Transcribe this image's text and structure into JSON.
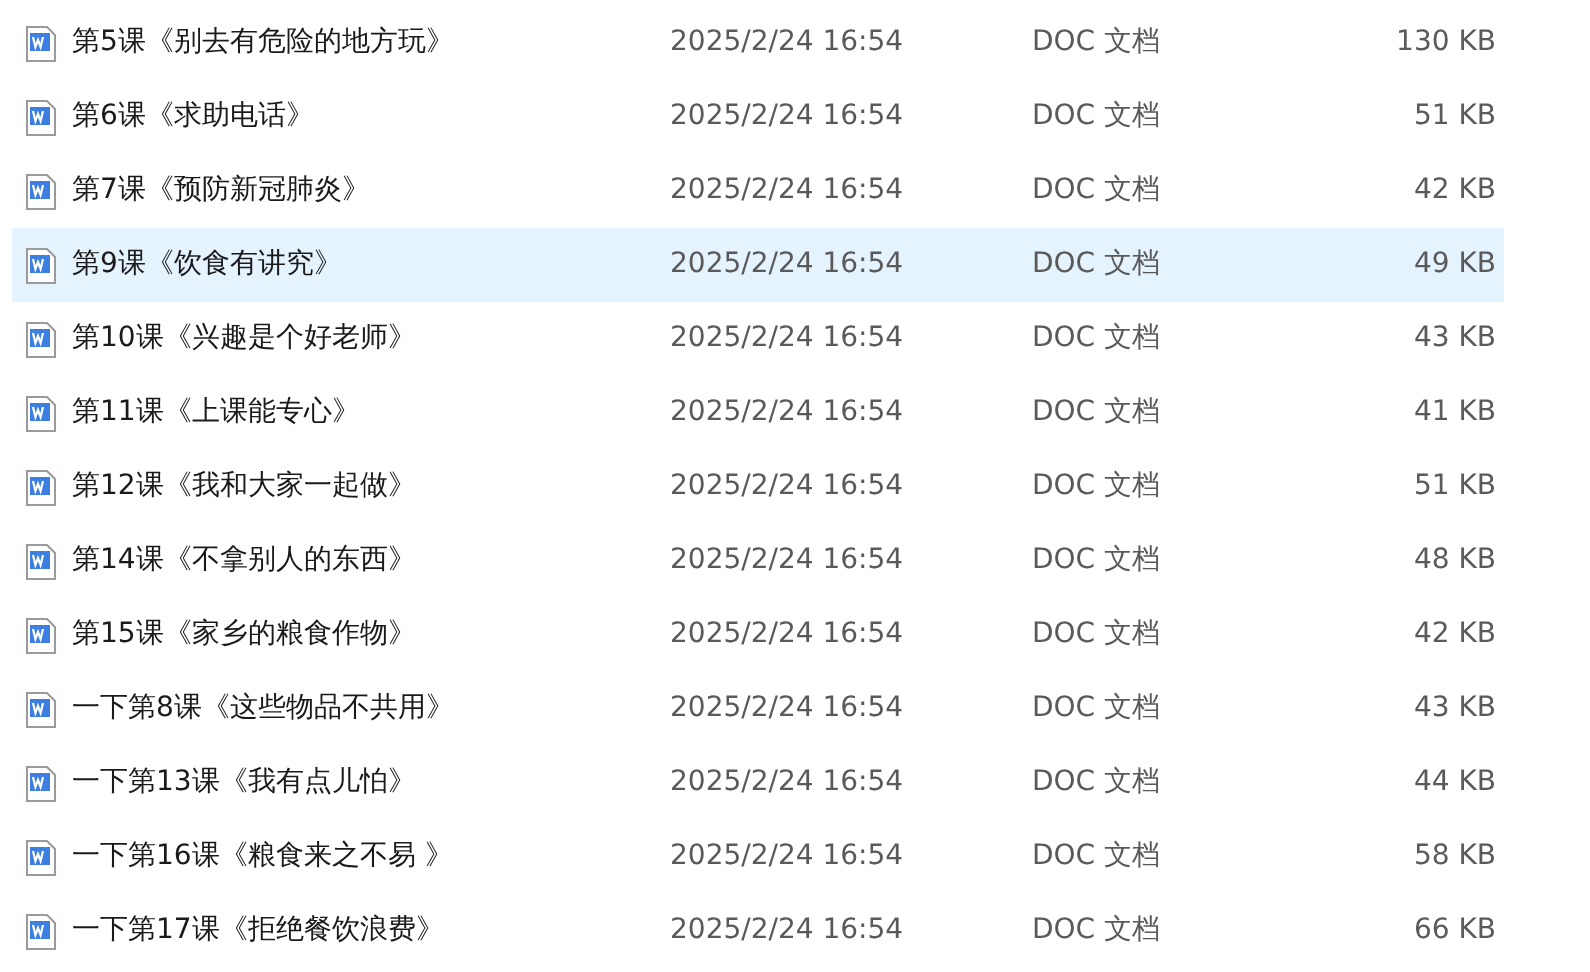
{
  "files": [
    {
      "name": "第5课《别去有危险的地方玩》",
      "modified": "2025/2/24 16:54",
      "type": "DOC 文档",
      "size": "130 KB",
      "selected": false
    },
    {
      "name": "第6课《求助电话》",
      "modified": "2025/2/24 16:54",
      "type": "DOC 文档",
      "size": "51 KB",
      "selected": false
    },
    {
      "name": "第7课《预防新冠肺炎》",
      "modified": "2025/2/24 16:54",
      "type": "DOC 文档",
      "size": "42 KB",
      "selected": false
    },
    {
      "name": "第9课《饮食有讲究》",
      "modified": "2025/2/24 16:54",
      "type": "DOC 文档",
      "size": "49 KB",
      "selected": true
    },
    {
      "name": "第10课《兴趣是个好老师》",
      "modified": "2025/2/24 16:54",
      "type": "DOC 文档",
      "size": "43 KB",
      "selected": false
    },
    {
      "name": "第11课《上课能专心》",
      "modified": "2025/2/24 16:54",
      "type": "DOC 文档",
      "size": "41 KB",
      "selected": false
    },
    {
      "name": "第12课《我和大家一起做》",
      "modified": "2025/2/24 16:54",
      "type": "DOC 文档",
      "size": "51 KB",
      "selected": false
    },
    {
      "name": "第14课《不拿别人的东西》",
      "modified": "2025/2/24 16:54",
      "type": "DOC 文档",
      "size": "48 KB",
      "selected": false
    },
    {
      "name": "第15课《家乡的粮食作物》",
      "modified": "2025/2/24 16:54",
      "type": "DOC 文档",
      "size": "42 KB",
      "selected": false
    },
    {
      "name": "一下第8课《这些物品不共用》",
      "modified": "2025/2/24 16:54",
      "type": "DOC 文档",
      "size": "43 KB",
      "selected": false
    },
    {
      "name": "一下第13课《我有点儿怕》",
      "modified": "2025/2/24 16:54",
      "type": "DOC 文档",
      "size": "44 KB",
      "selected": false
    },
    {
      "name": "一下第16课《粮食来之不易 》",
      "modified": "2025/2/24 16:54",
      "type": "DOC 文档",
      "size": "58 KB",
      "selected": false
    },
    {
      "name": "一下第17课《拒绝餐饮浪费》",
      "modified": "2025/2/24 16:54",
      "type": "DOC 文档",
      "size": "66 KB",
      "selected": false
    }
  ]
}
